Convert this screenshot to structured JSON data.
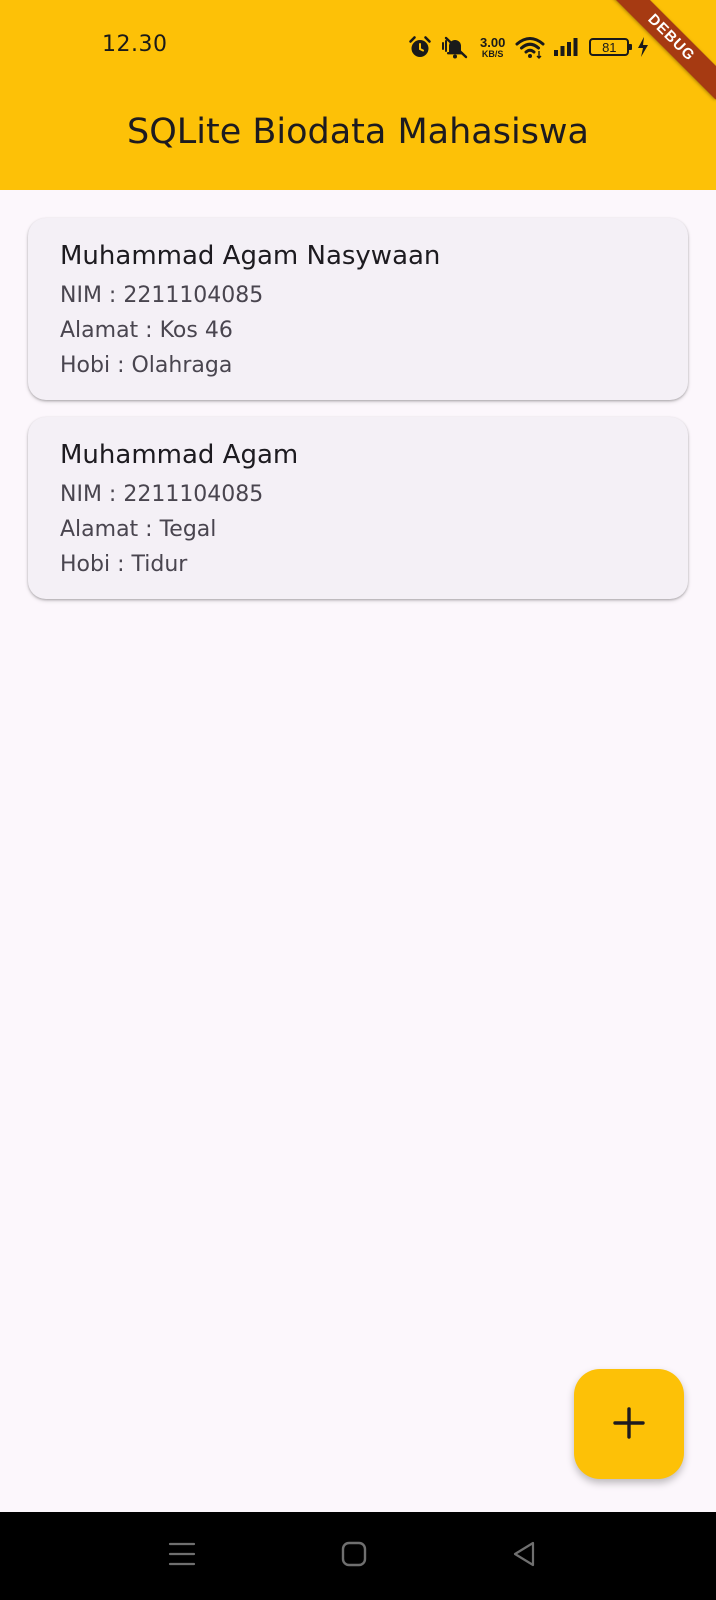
{
  "status_bar": {
    "time": "12.30",
    "net_speed_value": "3.00",
    "net_speed_unit": "KB/S",
    "battery_level": "81",
    "icons": [
      "alarm-icon",
      "vibrate-mute-icon",
      "wifi-icon",
      "signal-icon",
      "battery-icon",
      "charging-icon"
    ]
  },
  "debug_banner": "DEBUG",
  "app_bar": {
    "title": "SQLite Biodata Mahasiswa",
    "background_color": "#fdc107"
  },
  "students": [
    {
      "name": "Muhammad Agam Nasywaan",
      "nim": "NIM : 2211104085",
      "alamat": "Alamat : Kos 46",
      "hobi": "Hobi : Olahraga"
    },
    {
      "name": "Muhammad Agam",
      "nim": "NIM : 2211104085",
      "alamat": "Alamat : Tegal",
      "hobi": "Hobi : Tidur"
    }
  ],
  "fab": {
    "label": "+",
    "icon": "add-icon"
  },
  "nav_bar": {
    "buttons": [
      "menu-icon",
      "home-icon",
      "back-icon"
    ]
  }
}
